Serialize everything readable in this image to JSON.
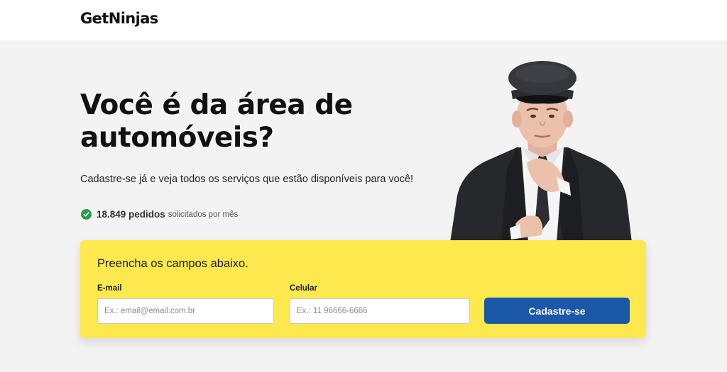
{
  "header": {
    "logo_text": "GetNinjas"
  },
  "hero": {
    "title_line1": "Você é da área de",
    "title_line2": "automóveis?",
    "subtitle": "Cadastre-se já e veja todos os serviços que estão disponíveis para você!"
  },
  "stats": {
    "count": "18.849 pedidos",
    "suffix": "solicitados por mês",
    "icon": "check-circle-icon"
  },
  "form": {
    "title": "Preencha os campos abaixo.",
    "email_label": "E-mail",
    "email_placeholder": "Ex.: email@email.com.br",
    "phone_label": "Celular",
    "phone_placeholder": "Ex.: 11 96666-6666",
    "submit_label": "Cadastre-se"
  },
  "colors": {
    "page_background": "#f3f3f3",
    "form_background": "#fde84e",
    "button": "#1c58a8",
    "check": "#2e9a4e"
  }
}
